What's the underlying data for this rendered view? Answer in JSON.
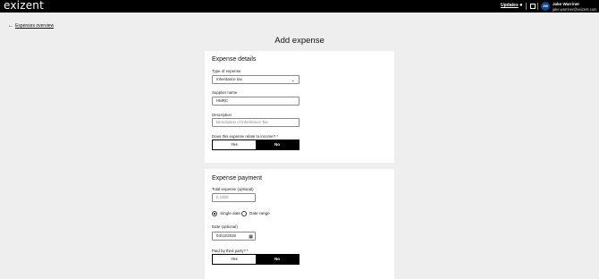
{
  "app": {
    "logo": "exizent"
  },
  "header": {
    "updates_label": "Updates",
    "bell_icon": "bell-icon",
    "apps_icon": "grid-icon",
    "avatar_initials": "JW",
    "user_name": "Jake Warriner",
    "user_email": "jake.warriner@exizent.com"
  },
  "nav": {
    "back_label": "Expenses overview"
  },
  "page": {
    "title": "Add expense"
  },
  "details": {
    "title": "Expense details",
    "type_label": "Type of expense",
    "type_value": "Inheritance tax",
    "supplier_label": "Supplier name",
    "supplier_value": "HMRC",
    "description_label": "Description",
    "description_placeholder": "Description of Inheritance Tax",
    "income_label": "Does this expense relate to income? *",
    "income_yes": "Yes",
    "income_no": "No",
    "income_selected": "No"
  },
  "payment": {
    "title": "Expense payment",
    "total_label": "Total expense (optional)",
    "total_value": "£ 1000",
    "single_date_label": "Single date",
    "date_range_label": "Date range",
    "date_mode_selected": "Single date",
    "date_label": "Date (optional)",
    "date_value": "04/12/2025",
    "third_party_label": "Paid by third party? *",
    "third_party_yes": "Yes",
    "third_party_no": "No",
    "third_party_selected": "No"
  }
}
